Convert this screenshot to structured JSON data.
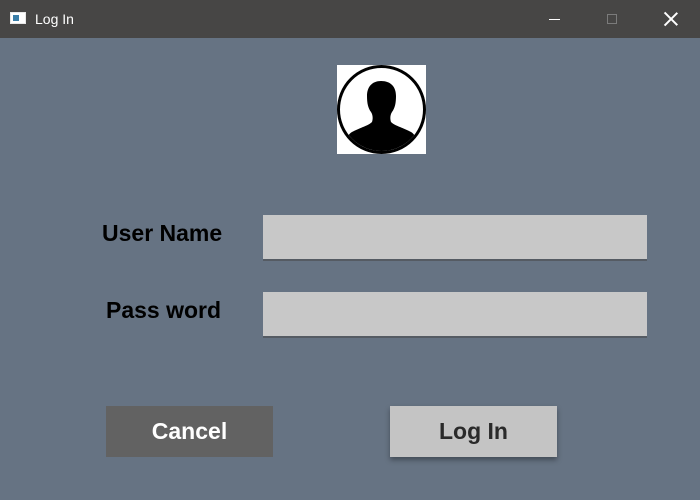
{
  "window": {
    "title": "Log In",
    "icon": "window-app-icon",
    "controls": [
      "minimize-icon",
      "maximize-icon",
      "close-icon"
    ]
  },
  "avatar": {
    "icon": "user-silhouette-icon"
  },
  "form": {
    "username_label": "User Name",
    "username_value": "",
    "password_label": "Pass word",
    "password_value": ""
  },
  "buttons": {
    "cancel_label": "Cancel",
    "login_label": "Log In"
  },
  "colors": {
    "background": "#667383",
    "titlebar": "#474645",
    "field": "#c8c8c8",
    "cancel_button": "#626262",
    "login_button": "#c4c4c4"
  }
}
